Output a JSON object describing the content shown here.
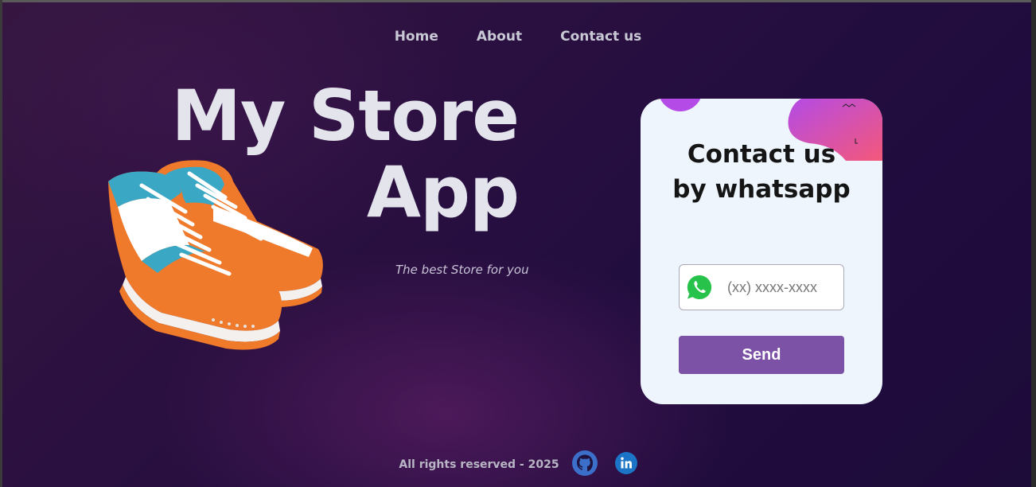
{
  "nav": {
    "items": [
      {
        "label": "Home"
      },
      {
        "label": "About"
      },
      {
        "label": "Contact us"
      }
    ]
  },
  "hero": {
    "title_line1": "My Store",
    "title_line2": "App",
    "tagline": "The best Store for you",
    "image": "sneakers-pair-orange-white-teal"
  },
  "contact_card": {
    "title_line1": "Contact us",
    "title_line2": "by whatsapp",
    "phone_placeholder": "(xx) xxxx-xxxx",
    "phone_icon": "whatsapp-icon",
    "send_label": "Send",
    "button_color": "#7b52a5"
  },
  "footer": {
    "text": "All rights reserved - 2025",
    "icons": [
      "github-icon",
      "linkedin-icon"
    ]
  },
  "colors": {
    "background": "#2a1040",
    "card": "#eef5fd",
    "title": "#e4e4ec",
    "accent_pink": "#f4587a",
    "accent_purple": "#b44be6"
  }
}
